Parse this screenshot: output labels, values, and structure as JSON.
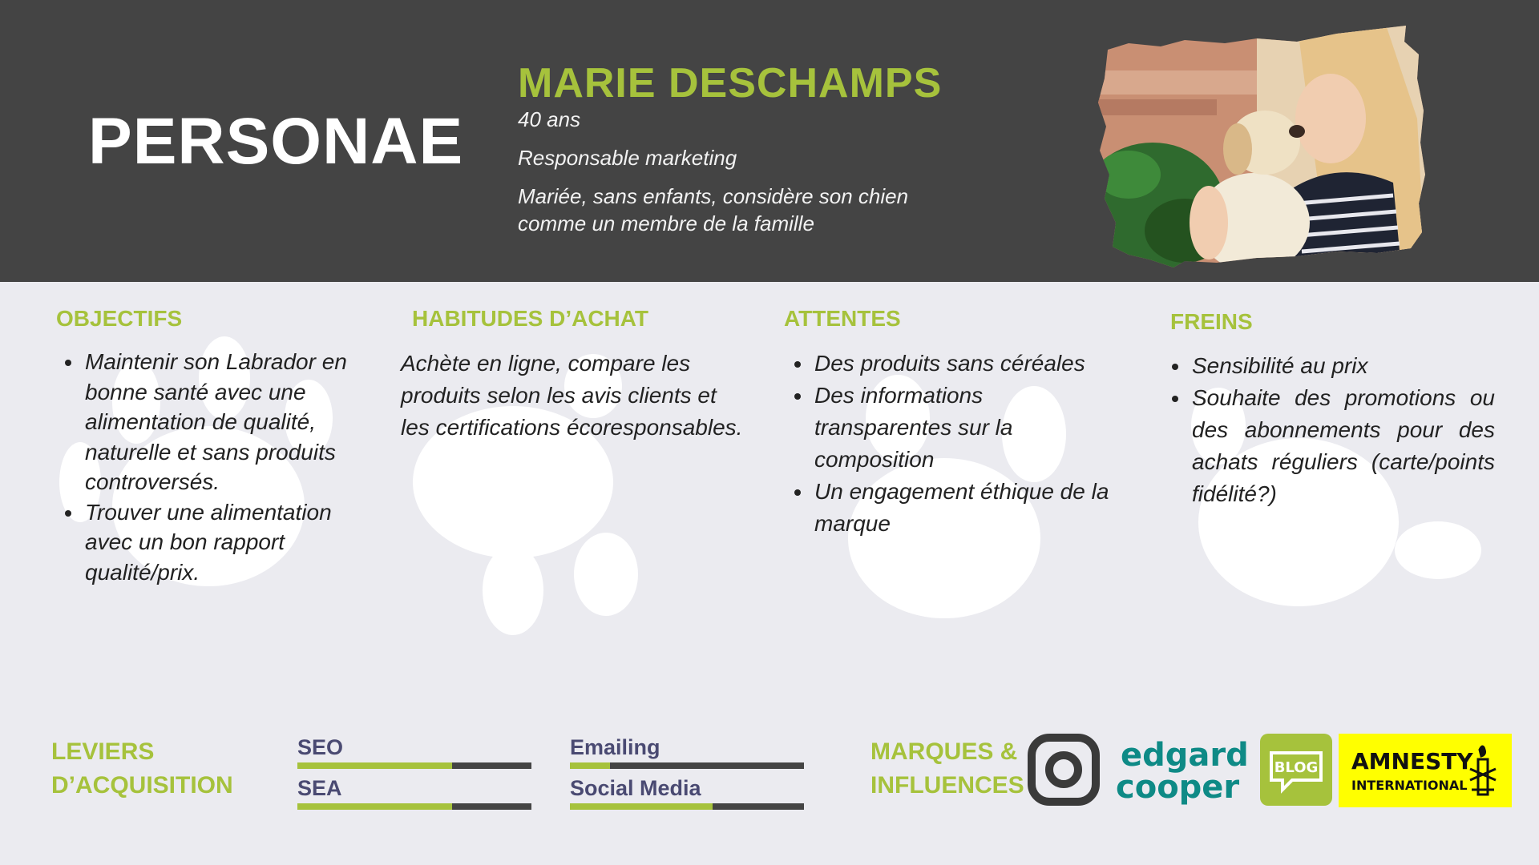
{
  "header": {
    "title": "PERSONAE",
    "name": "MARIE DESCHAMPS",
    "age": "40 ans",
    "job": "Responsable marketing",
    "family_line1": "Mariée, sans enfants, considère son chien",
    "family_line2": "comme un membre de la famille"
  },
  "sections": {
    "objectifs": {
      "title": "OBJECTIFS",
      "items": [
        "Maintenir son Labrador en bonne santé avec une alimentation de qualité, naturelle et sans produits controversés.",
        "Trouver une alimentation avec un bon rapport qualité/prix."
      ]
    },
    "habitudes": {
      "title": "HABITUDES D’ACHAT",
      "text": "Achète en ligne, compare les produits selon les avis clients et les certifications écoresponsables."
    },
    "attentes": {
      "title": "ATTENTES",
      "items": [
        "Des produits sans céréales",
        "Des informations transparentes sur la composition",
        "Un engagement éthique de la marque"
      ]
    },
    "freins": {
      "title": "FREINS",
      "items": [
        "Sensibilité au prix",
        "Souhaite des promotions ou des abonnements pour des achats réguliers (carte/points fidélité?)"
      ]
    }
  },
  "leviers": {
    "title_line1": "LEVIERS",
    "title_line2": "D’ACQUISITION",
    "items": [
      {
        "label": "SEO",
        "level": 0.66
      },
      {
        "label": "SEA",
        "level": 0.66
      },
      {
        "label": "Emailing",
        "level": 0.17
      },
      {
        "label": "Social Media",
        "level": 0.61
      }
    ]
  },
  "brands": {
    "title_line1": "MARQUES &",
    "title_line2": "INFLUENCES",
    "edgard_line1": "edgard",
    "edgard_line2": "cooper",
    "blog": "BLOG",
    "amnesty_line1": "AMNESTY",
    "amnesty_line2": "INTERNATIONAL"
  },
  "colors": {
    "accent": "#a6c23c",
    "header_bg": "#444444",
    "background": "#ebebf0",
    "lever_label": "#4a4a72",
    "edgard_teal": "#0e8a86",
    "amnesty_yellow": "#ffff00"
  }
}
